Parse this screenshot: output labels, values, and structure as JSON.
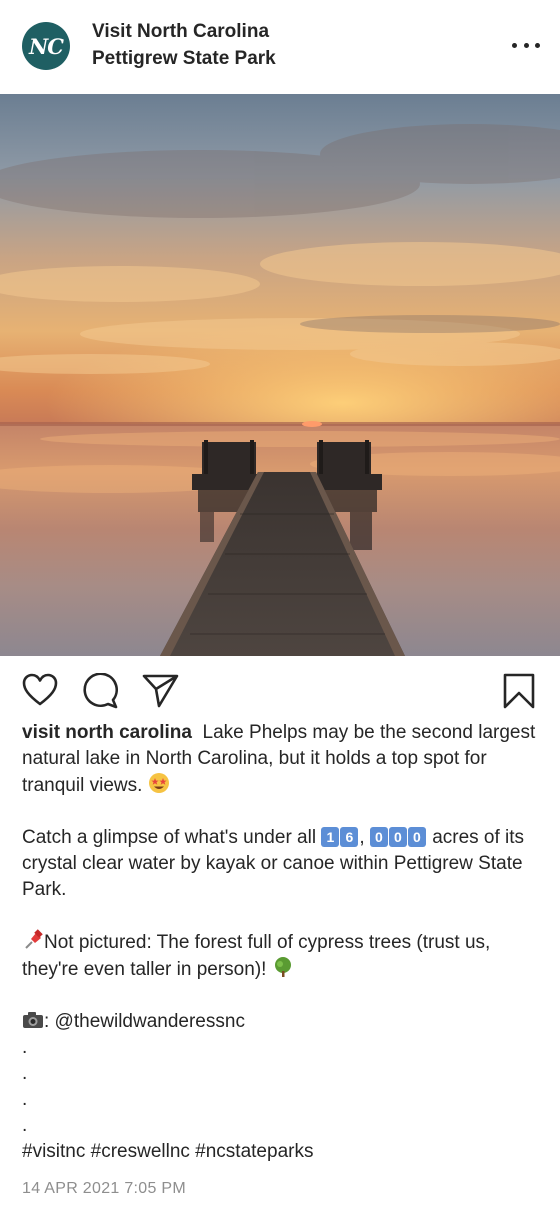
{
  "header": {
    "avatar_text": "NC",
    "account_name": "Visit North Carolina",
    "location": "Pettigrew State Park",
    "more_icon": "more-horizontal-icon"
  },
  "actions": {
    "like_icon": "heart-icon",
    "comment_icon": "comment-icon",
    "share_icon": "send-icon",
    "save_icon": "bookmark-icon"
  },
  "caption": {
    "username": "visit north carolina",
    "para1": "Lake Phelps may be the second largest natural lake in North Carolina, but it holds a top spot for tranquil views.",
    "para2_a": "Catch a glimpse of what's under all",
    "keycap_1": "1",
    "keycap_6": "6",
    "keycap_0a": "0",
    "keycap_0b": "0",
    "keycap_0c": "0",
    "para2_comma": ",",
    "para2_b": "acres of its crystal clear water by kayak or canoe within Pettigrew State Park.",
    "para3": "Not pictured: The forest full of cypress trees (trust us, they're even taller in person)!",
    "credit": ": @thewildwanderessnc",
    "dot": ".",
    "hashtags": "#visitnc #creswellnc #ncstateparks"
  },
  "timestamp": "14 APR 2021 7:05 PM",
  "colors": {
    "avatar_bg": "#1f5f63",
    "text": "#262626",
    "muted": "#8e8e8e"
  }
}
